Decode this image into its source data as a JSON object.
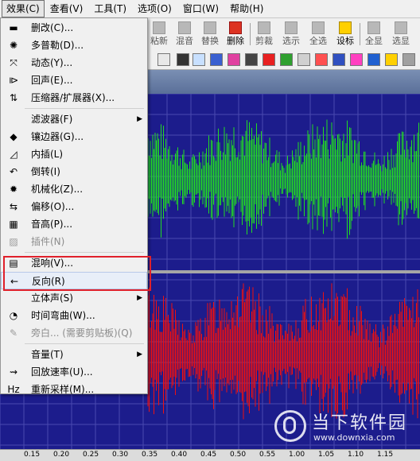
{
  "menubar": {
    "items": [
      "效果(C)",
      "查看(V)",
      "工具(T)",
      "选项(O)",
      "窗口(W)",
      "帮助(H)"
    ]
  },
  "toolbar": {
    "buttons": [
      "粘新",
      "混音",
      "替换",
      "删除",
      "剪裁",
      "选示",
      "全选",
      "设标",
      "全显",
      "选显"
    ]
  },
  "effects_menu": {
    "items": [
      {
        "label": "删改(C)...",
        "icon": "cut-icon"
      },
      {
        "label": "多普勒(D)...",
        "icon": "doppler-icon"
      },
      {
        "label": "动态(Y)...",
        "icon": "dynamics-icon"
      },
      {
        "label": "回声(E)...",
        "icon": "echo-icon"
      },
      {
        "label": "压缩器/扩展器(X)...",
        "icon": "compressor-icon"
      },
      {
        "label": "滤波器(F)",
        "icon": "",
        "submenu": true
      },
      {
        "label": "镶边器(G)...",
        "icon": "flanger-icon"
      },
      {
        "label": "内插(L)",
        "icon": "interpolate-icon"
      },
      {
        "label": "倒转(I)",
        "icon": "invert-icon"
      },
      {
        "label": "机械化(Z)...",
        "icon": "mechanize-icon"
      },
      {
        "label": "偏移(O)...",
        "icon": "offset-icon"
      },
      {
        "label": "音高(P)...",
        "icon": "pitch-icon"
      },
      {
        "label": "插件(N)",
        "icon": "plugin-icon",
        "disabled": true
      },
      {
        "label": "混响(V)...",
        "icon": "reverb-icon"
      },
      {
        "label": "反向(R)",
        "icon": "reverse-icon"
      },
      {
        "label": "立体声(S)",
        "icon": "",
        "submenu": true
      },
      {
        "label": "时间弯曲(W)...",
        "icon": "time-warp-icon"
      },
      {
        "label": "旁白... (需要剪贴板)(Q)",
        "icon": "voiceover-icon",
        "disabled": true
      },
      {
        "label": "音量(T)",
        "icon": "",
        "submenu": true
      },
      {
        "label": "回放速率(U)...",
        "icon": "playback-rate-icon"
      },
      {
        "label": "重新采样(M)...",
        "icon": "resample-icon"
      }
    ]
  },
  "timeline": {
    "ticks": [
      "0.15",
      "0.20",
      "0.25",
      "0.30",
      "0.35",
      "0.40",
      "0.45",
      "0.50",
      "0.55",
      "1.00",
      "1.05",
      "1.10",
      "1.15"
    ]
  },
  "watermark": {
    "title": "当下软件园",
    "url": "www.downxia.com"
  },
  "colors": {
    "wave_background": "#1c1c8c",
    "left_channel": "#22dd22",
    "right_channel": "#ee1111",
    "highlight_box": "#e0202a"
  }
}
